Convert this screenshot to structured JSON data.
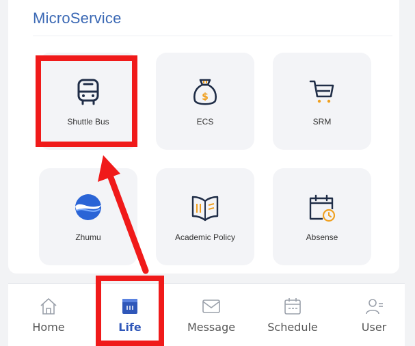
{
  "section": {
    "title": "MicroService"
  },
  "services": [
    {
      "label": "Shuttle Bus",
      "icon": "bus-icon"
    },
    {
      "label": "ECS",
      "icon": "money-bag-icon"
    },
    {
      "label": "SRM",
      "icon": "shopping-cart-icon"
    },
    {
      "label": "Zhumu",
      "icon": "zhumu-logo-icon"
    },
    {
      "label": "Academic Policy",
      "icon": "book-icon"
    },
    {
      "label": "Absense",
      "icon": "calendar-clock-icon"
    }
  ],
  "tabbar": {
    "items": [
      {
        "label": "Home",
        "icon": "home-icon",
        "active": false
      },
      {
        "label": "Life",
        "icon": "life-icon",
        "active": true
      },
      {
        "label": "Message",
        "icon": "message-icon",
        "active": false
      },
      {
        "label": "Schedule",
        "icon": "schedule-icon",
        "active": false
      },
      {
        "label": "User",
        "icon": "user-icon",
        "active": false
      }
    ]
  },
  "colors": {
    "accent": "#2f57b9",
    "title": "#3a68b4",
    "annotation": "#f01a1a",
    "coin_gold": "#f0a020"
  }
}
